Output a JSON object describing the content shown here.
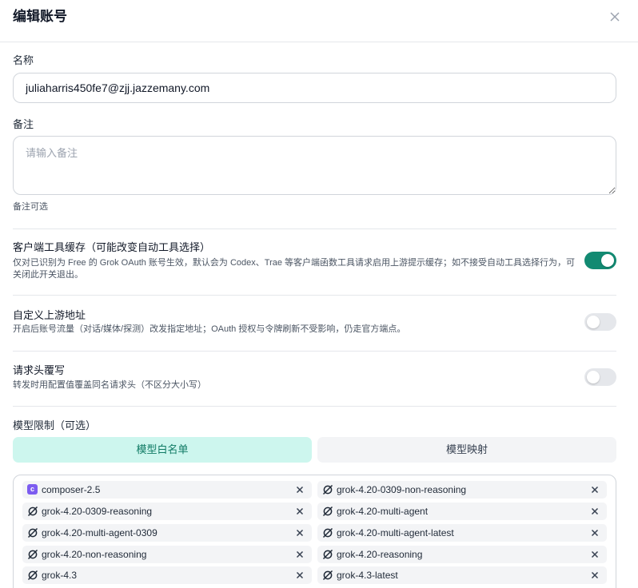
{
  "dialog": {
    "title": "编辑账号"
  },
  "name_field": {
    "label": "名称",
    "value": "juliaharris450fe7@zjj.jazzemany.com"
  },
  "notes_field": {
    "label": "备注",
    "placeholder": "请输入备注",
    "hint": "备注可选"
  },
  "options": {
    "client_tool_cache": {
      "title": "客户端工具缓存（可能改变自动工具选择）",
      "description": "仅对已识别为 Free 的 Grok OAuth 账号生效，默认会为 Codex、Trae 等客户端函数工具请求启用上游提示缓存；如不接受自动工具选择行为，可关闭此开关退出。",
      "enabled": true
    },
    "custom_upstream": {
      "title": "自定义上游地址",
      "description": "开启后账号流量（对话/媒体/探测）改发指定地址；OAuth 授权与令牌刷新不受影响，仍走官方端点。",
      "enabled": false
    },
    "header_override": {
      "title": "请求头覆写",
      "description": "转发时用配置值覆盖同名请求头（不区分大小写）",
      "enabled": false
    }
  },
  "model_limit": {
    "title": "模型限制（可选）",
    "tabs": [
      {
        "label": "模型白名单",
        "active": true
      },
      {
        "label": "模型映射",
        "active": false
      }
    ],
    "models": [
      {
        "name": "composer-2.5",
        "icon": "cursor-c-icon"
      },
      {
        "name": "grok-4.20-0309-non-reasoning",
        "icon": "grok-icon"
      },
      {
        "name": "grok-4.20-0309-reasoning",
        "icon": "grok-icon"
      },
      {
        "name": "grok-4.20-multi-agent",
        "icon": "grok-icon"
      },
      {
        "name": "grok-4.20-multi-agent-0309",
        "icon": "grok-icon"
      },
      {
        "name": "grok-4.20-multi-agent-latest",
        "icon": "grok-icon"
      },
      {
        "name": "grok-4.20-non-reasoning",
        "icon": "grok-icon"
      },
      {
        "name": "grok-4.20-reasoning",
        "icon": "grok-icon"
      },
      {
        "name": "grok-4.3",
        "icon": "grok-icon"
      },
      {
        "name": "grok-4.3-latest",
        "icon": "grok-icon"
      }
    ]
  },
  "colors": {
    "accent": "#128a72",
    "tab_active_bg": "#cdf6ee",
    "tab_active_text": "#0f7a64",
    "badge_c": "#7c5cf0"
  }
}
